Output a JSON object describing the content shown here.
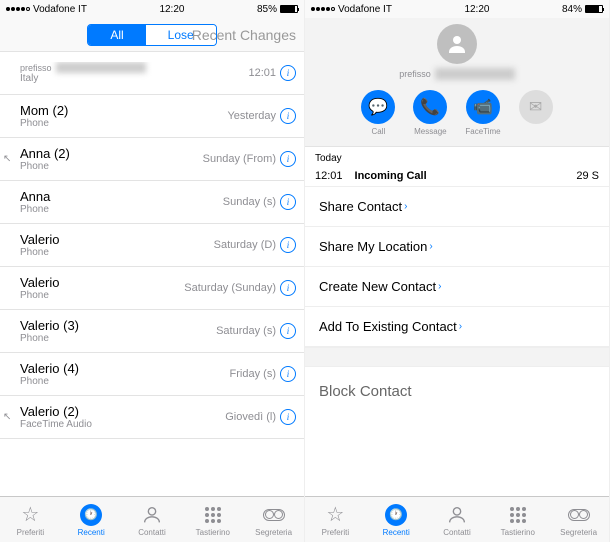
{
  "left": {
    "status": {
      "carrier": "Vodafone IT",
      "time": "12:20",
      "battery": "85%",
      "battery_fill": 85
    },
    "segmented": {
      "all": "All",
      "lose": "Lose"
    },
    "recent_changes": "Recent Changes",
    "calls": [
      {
        "prefix": "prefisso",
        "name": "",
        "sub": "Italy",
        "when": "12:01",
        "blur": true,
        "icon": false
      },
      {
        "name": "Mom (2)",
        "sub": "Phone",
        "when": "Yesterday",
        "icon": false
      },
      {
        "name": "Anna (2)",
        "sub": "Phone",
        "when": "Sunday (From)",
        "icon": true
      },
      {
        "name": "Anna",
        "sub": "Phone",
        "when": "Sunday (s)",
        "icon": false
      },
      {
        "name": "Valerio",
        "sub": "Phone",
        "when": "Saturday (D)",
        "icon": false
      },
      {
        "name": "Valerio",
        "sub": "Phone",
        "when": "Saturday (Sunday)",
        "icon": false
      },
      {
        "name": "Valerio (3)",
        "sub": "Phone",
        "when": "Saturday (s)",
        "icon": false
      },
      {
        "name": "Valerio (4)",
        "sub": "Phone",
        "when": "Friday (s)",
        "icon": false
      },
      {
        "name": "Valerio (2)",
        "sub": "FaceTime Audio",
        "when": "Giovedì (l)",
        "icon": true
      }
    ],
    "tabs": [
      {
        "label": "Preferiti",
        "icon": "star"
      },
      {
        "label": "Recenti",
        "icon": "clock",
        "active": true
      },
      {
        "label": "Contatti",
        "icon": "person"
      },
      {
        "label": "Tastierino",
        "icon": "keypad"
      },
      {
        "label": "Segreteria",
        "icon": "vm"
      }
    ]
  },
  "right": {
    "status": {
      "carrier": "Vodafone IT",
      "time": "12:20",
      "battery": "84%",
      "battery_fill": 84
    },
    "contact": {
      "prefix": "prefisso",
      "name": ""
    },
    "actions": [
      {
        "label": "Call",
        "icon": "message",
        "color": "blue"
      },
      {
        "label": "Message",
        "icon": "phone",
        "color": "blue"
      },
      {
        "label": "FaceTime",
        "icon": "video",
        "color": "blue"
      },
      {
        "label": "",
        "icon": "mail",
        "color": "gray"
      }
    ],
    "log": {
      "header": "Today",
      "time": "12:01",
      "type": "Incoming Call",
      "duration": "29 S"
    },
    "menus": [
      "Share Contact",
      "Share My Location",
      "Create New Contact",
      "Add To Existing Contact"
    ],
    "block": "Block Contact",
    "tabs": [
      {
        "label": "Preferiti",
        "icon": "star"
      },
      {
        "label": "Recenti",
        "icon": "clock",
        "active": true
      },
      {
        "label": "Contatti",
        "icon": "person"
      },
      {
        "label": "Tastierino",
        "icon": "keypad"
      },
      {
        "label": "Segreteria",
        "icon": "vm"
      }
    ]
  }
}
